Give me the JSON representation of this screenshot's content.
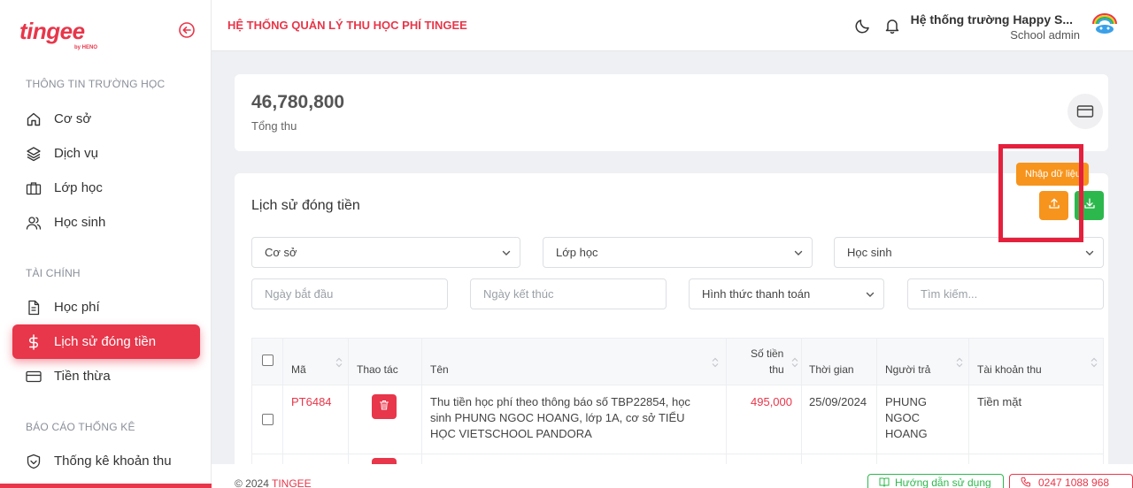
{
  "app": {
    "logo_text": "tingee",
    "logo_sub": "by HENO",
    "header_title": "HỆ THỐNG QUẢN LÝ THU HỌC PHÍ TINGEE"
  },
  "user": {
    "school_name": "Hệ thống trường Happy S...",
    "role": "School admin"
  },
  "sidebar": {
    "sections": [
      {
        "title": "THÔNG TIN TRƯỜNG HỌC",
        "items": [
          {
            "label": "Cơ sở",
            "icon": "home-icon"
          },
          {
            "label": "Dịch vụ",
            "icon": "layers-icon"
          },
          {
            "label": "Lớp học",
            "icon": "briefcase-icon"
          },
          {
            "label": "Học sinh",
            "icon": "users-icon"
          }
        ]
      },
      {
        "title": "TÀI CHÍNH",
        "items": [
          {
            "label": "Học phí",
            "icon": "file-icon"
          },
          {
            "label": "Lịch sử đóng tiền",
            "icon": "dollar-icon",
            "active": true
          },
          {
            "label": "Tiền thừa",
            "icon": "credit-card-icon"
          }
        ]
      },
      {
        "title": "BÁO CÁO THỐNG KÊ",
        "items": [
          {
            "label": "Thống kê khoản thu",
            "icon": "shield-icon"
          }
        ]
      }
    ]
  },
  "summary": {
    "total_value": "46,780,800",
    "total_label": "Tổng thu"
  },
  "history": {
    "title": "Lịch sử đóng tiền",
    "import_tooltip": "Nhập dữ liệu",
    "filters": {
      "campus": "Cơ sở",
      "class": "Lớp học",
      "student": "Học sinh",
      "start_date_placeholder": "Ngày bắt đầu",
      "end_date_placeholder": "Ngày kết thúc",
      "payment_method": "Hình thức thanh toán",
      "search_placeholder": "Tìm kiếm..."
    },
    "columns": {
      "code": "Mã",
      "action": "Thao tác",
      "name": "Tên",
      "amount_line1": "Số tiền",
      "amount_line2": "thu",
      "time": "Thời gian",
      "payer": "Người trả",
      "account": "Tài khoản thu"
    },
    "rows": [
      {
        "code": "PT6484",
        "name": "Thu tiền học phí theo thông báo số TBP22854, học sinh PHUNG NGOC HOANG, lớp 1A, cơ sở TIỂU HỌC VIETSCHOOL PANDORA",
        "amount": "495,000",
        "time": "25/09/2024",
        "payer": "PHUNG NGOC HOANG",
        "account": "Tiền mặt"
      }
    ]
  },
  "footer": {
    "copyright_prefix": "© 2024",
    "brand": "TINGEE",
    "guide": "Hướng dẫn sử dụng",
    "phone": "0247 1088 968"
  },
  "colors": {
    "brand": "#e8364a",
    "orange": "#f7941d",
    "green": "#2db84d",
    "highlight": "#e5203d"
  }
}
